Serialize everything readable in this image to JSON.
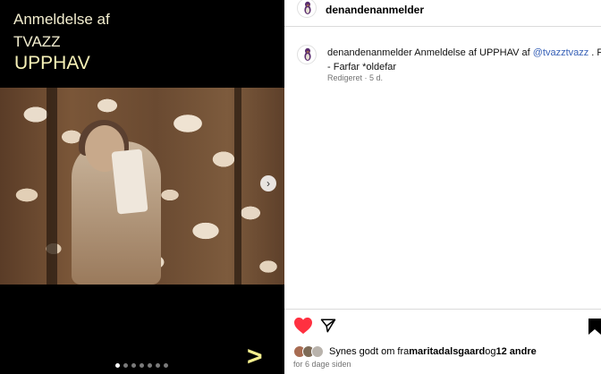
{
  "media": {
    "caption_line1": "Anmeldelse af",
    "caption_line2": "TVAZZ",
    "caption_line3": "UPPHAV",
    "next_glyph": "›",
    "big_arrow_glyph": ">",
    "carousel": {
      "count": 7,
      "active_index": 0
    }
  },
  "header": {
    "username": "denandenanmelder"
  },
  "post": {
    "author": "denandenanmelder",
    "text_part1": "Anmeldelse af UPPHAV af ",
    "mention": "@tvazztvazz",
    "text_part2": " . Fejl",
    "line2": "- Farfar *oldefar",
    "meta": "Redigeret · 5 d."
  },
  "actions": {
    "heart_icon": "heart-filled-icon",
    "share_icon": "paper-plane-icon",
    "bookmark_icon": "bookmark-icon",
    "colors": {
      "heart": "#ff3040",
      "link": "#355fb6"
    }
  },
  "likes": {
    "prefix": "Synes godt om fra ",
    "user": "maritadalsgaard",
    "conjunction": " og ",
    "others": "12 andre"
  },
  "timestamp": "for 6 dage siden"
}
